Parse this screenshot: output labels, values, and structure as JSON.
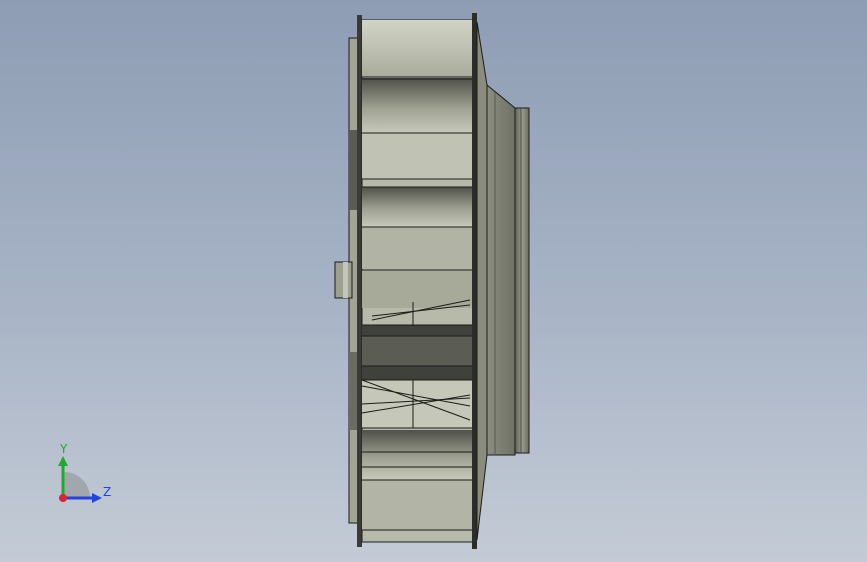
{
  "viewport": {
    "background_top": "#8e9db4",
    "background_bottom": "#c4cbd6"
  },
  "model": {
    "description_icon": "centrifugal-fan-impeller",
    "body_color": "#b3b5a6",
    "shadow_color": "#4e5049",
    "edge_color": "#1b1c1a"
  },
  "triad": {
    "y_label": "Y",
    "z_label": "Z",
    "y_color": "#1faa2e",
    "z_color": "#2244dd",
    "x_color": "#d9262b"
  }
}
